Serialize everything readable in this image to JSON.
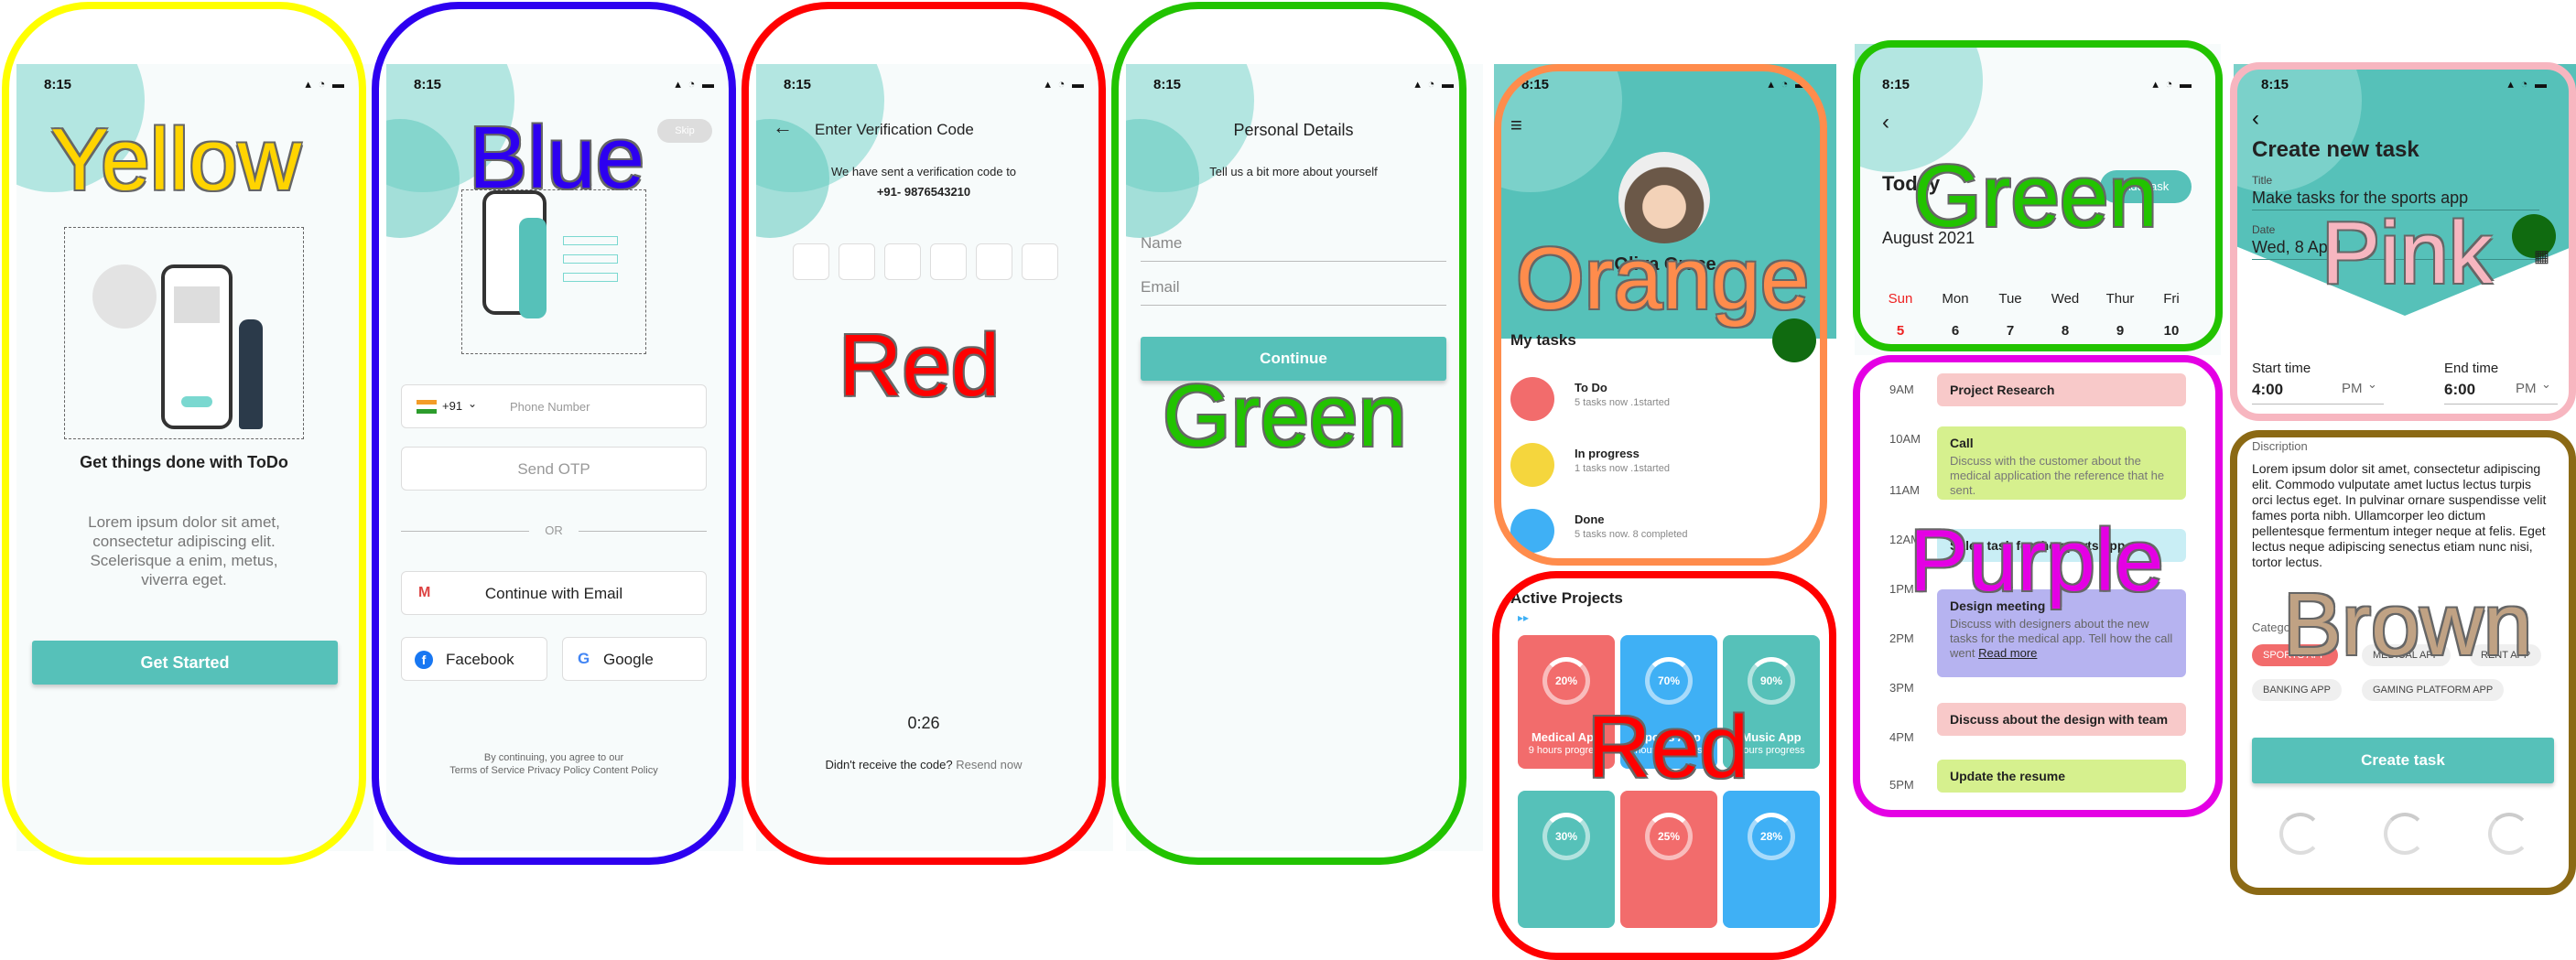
{
  "status_time": "8:15",
  "status_icons": "▴ ◔ ▬",
  "frames": {
    "yellow": "Yellow",
    "blue": "Blue",
    "red1": "Red",
    "green1": "Green",
    "orange": "Orange",
    "red2": "Red",
    "green2": "Green",
    "purple": "Purple",
    "pink": "Pink",
    "brown": "Brown"
  },
  "colors": {
    "teal": "#56c1b9",
    "yellow": "#ffff00",
    "blue": "#2d00f0",
    "red": "#ff0000",
    "green": "#22c300",
    "orange": "#ff8c4c",
    "purple": "#e400e4",
    "pink": "#f7b6c0",
    "brown": "#8b6914"
  },
  "onboarding": {
    "heading": "Get things done with ToDo",
    "body": "Lorem ipsum dolor sit amet, consectetur adipiscing elit. Scelerisque a enim, metus, viverra eget.",
    "cta": "Get Started"
  },
  "login": {
    "skip": "Skip",
    "country_code": "+91",
    "phone_placeholder": "Phone Number",
    "send_otp": "Send OTP",
    "or": "OR",
    "email_btn": "Continue with Email",
    "facebook": "Facebook",
    "google": "Google",
    "terms_line1": "By continuing, you agree to our",
    "terms_line2": "Terms of Service Privacy Policy Content Policy"
  },
  "verify": {
    "title": "Enter Verification Code",
    "subtitle": "We have sent a verification code to",
    "phone": "+91- 9876543210",
    "timer": "0:26",
    "resend_prompt": "Didn't receive the code?",
    "resend_link": "Resend now"
  },
  "details": {
    "title": "Personal Details",
    "subtitle": "Tell us a bit more about yourself",
    "name_label": "Name",
    "email_label": "Email",
    "cta": "Continue"
  },
  "dashboard": {
    "user_name": "Oliva Grace",
    "section_title": "My tasks",
    "tasks": [
      {
        "title": "To Do",
        "sub": "5 tasks now .1started",
        "color": "#f26c6c"
      },
      {
        "title": "In progress",
        "sub": "1 tasks now .1started",
        "color": "#f5d63d"
      },
      {
        "title": "Done",
        "sub": "5 tasks now. 8 completed",
        "color": "#3fb0f5"
      }
    ],
    "projects_title": "Active Projects",
    "projects": [
      {
        "pct": "20%",
        "name": "Medical App",
        "sub": "9 hours progress",
        "color": "#f26c6c"
      },
      {
        "pct": "70%",
        "name": "Sports App",
        "sub": "hours progress",
        "color": "#3fb0f5"
      },
      {
        "pct": "90%",
        "name": "Music App",
        "sub": "hours progress",
        "color": "#56c1b9"
      },
      {
        "pct": "30%",
        "name": "",
        "sub": "",
        "color": "#56c1b9"
      },
      {
        "pct": "25%",
        "name": "",
        "sub": "",
        "color": "#f26c6c"
      },
      {
        "pct": "28%",
        "name": "",
        "sub": "",
        "color": "#3fb0f5"
      }
    ]
  },
  "schedule": {
    "today": "Today",
    "add_task": "Add task",
    "month": "August 2021",
    "days": [
      {
        "name": "Sun",
        "num": "5"
      },
      {
        "name": "Mon",
        "num": "6"
      },
      {
        "name": "Tue",
        "num": "7"
      },
      {
        "name": "Wed",
        "num": "8"
      },
      {
        "name": "Thur",
        "num": "9"
      },
      {
        "name": "Fri",
        "num": "10"
      }
    ],
    "times": [
      "9AM",
      "10AM",
      "11AM",
      "12AM",
      "1PM",
      "2PM",
      "3PM",
      "4PM",
      "5PM"
    ],
    "events": [
      {
        "title": "Project Research",
        "desc": "",
        "color": "#f8c9c9"
      },
      {
        "title": "Call",
        "desc": "Discuss with the customer about the medical application the reference that he sent.",
        "color": "#d6f08e"
      },
      {
        "title": "Sales task for the sports app",
        "desc": "",
        "color": "#c9eef5"
      },
      {
        "title": "Design meeting",
        "desc": "Discuss with designers about the new tasks for the medical app. Tell how the call went",
        "link": "Read more",
        "color": "#b6b3f0"
      },
      {
        "title": "Discuss about the design with team",
        "desc": "",
        "color": "#f8c9c9"
      },
      {
        "title": "Update the resume",
        "desc": "",
        "color": "#d6f08e"
      }
    ]
  },
  "create": {
    "title": "Create new task",
    "title_label": "Title",
    "title_value": "Make tasks for the sports app",
    "date_label": "Date",
    "date_value": "Wed, 8 April",
    "start_label": "Start time",
    "start_value": "4:00",
    "start_ampm": "PM",
    "end_label": "End time",
    "end_value": "6:00",
    "end_ampm": "PM",
    "desc_label": "Discription",
    "desc_value": "Lorem ipsum dolor sit amet, consectetur adipiscing elit. Commodo vulputate amet luctus lectus turpis orci lectus eget. In pulvinar ornare suspendisse velit fames porta nibh. Ullamcorper leo dictum pellentesque fermentum integer neque at felis. Eget lectus neque adipiscing senectus etiam nunc nisi, tortor lectus.",
    "category_label": "Category",
    "categories": [
      "SPORTS APP",
      "MEDICAL APP",
      "RENT APP",
      "BANKING APP",
      "GAMING PLATFORM APP"
    ],
    "cta": "Create task"
  }
}
